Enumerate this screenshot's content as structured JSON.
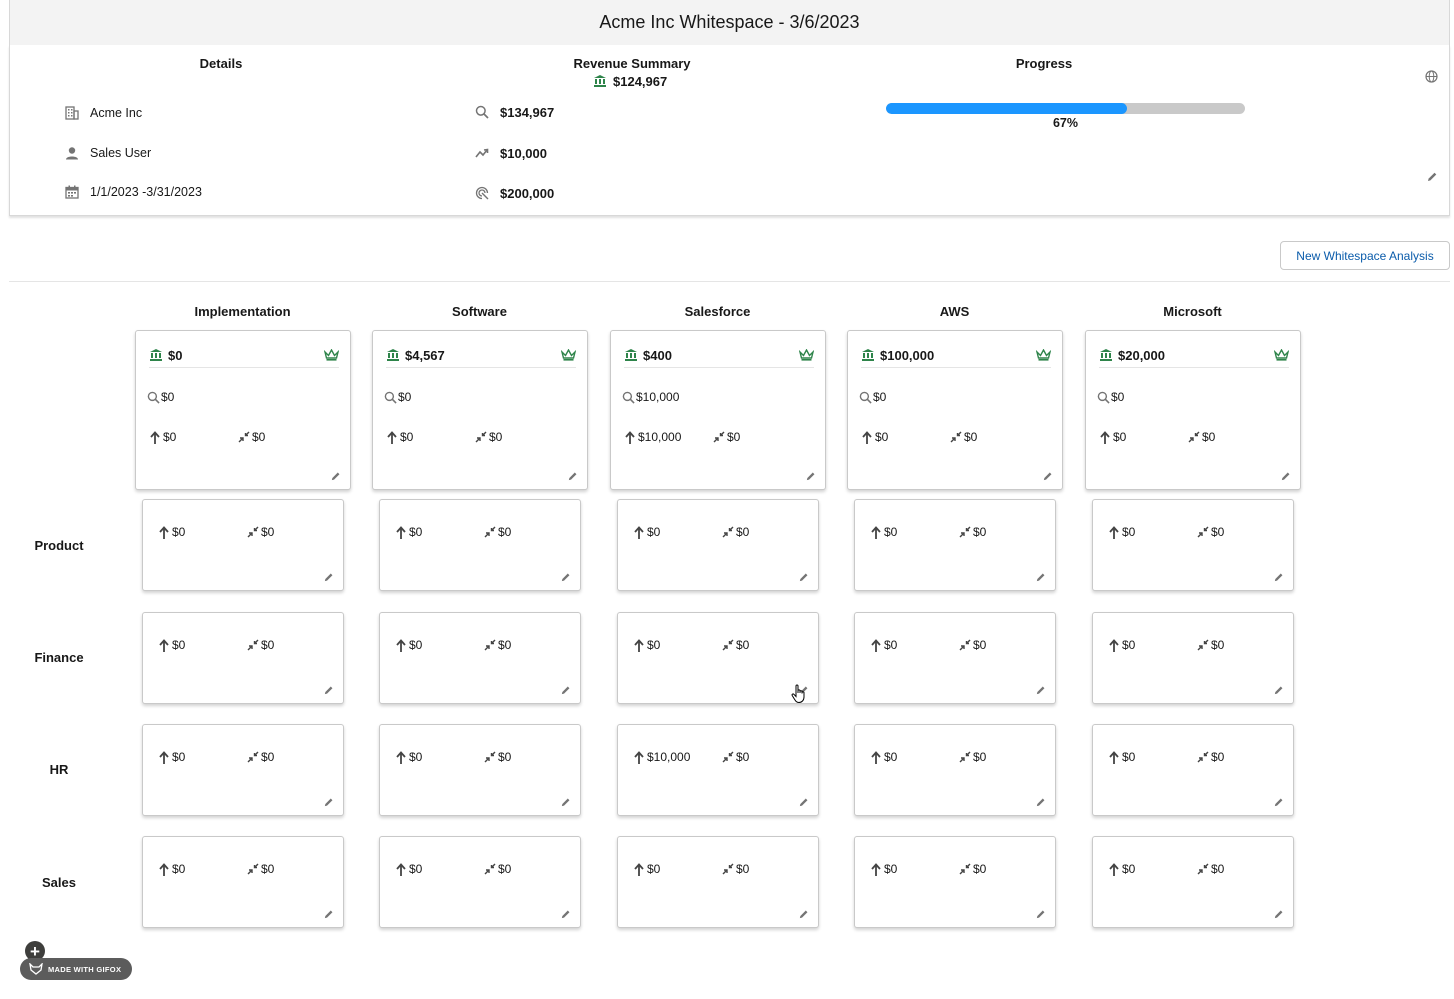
{
  "header": {
    "title": "Acme Inc Whitespace - 3/6/2023"
  },
  "details": {
    "heading": "Details",
    "account": "Acme Inc",
    "owner": "Sales User",
    "date_range": "1/1/2023 -3/31/2023"
  },
  "revenue_summary": {
    "heading": "Revenue Summary",
    "total": "$124,967",
    "pipeline": "$134,967",
    "growth": "$10,000",
    "target": "$200,000"
  },
  "progress": {
    "heading": "Progress",
    "percent_label": "67%",
    "value": 0.67
  },
  "actions": {
    "new_analysis_label": "New Whitespace Analysis"
  },
  "columns": [
    {
      "name": "Implementation",
      "total": "$0",
      "search": "$0",
      "up": "$0",
      "shrink": "$0"
    },
    {
      "name": "Software",
      "total": "$4,567",
      "search": "$0",
      "up": "$0",
      "shrink": "$0"
    },
    {
      "name": "Salesforce",
      "total": "$400",
      "search": "$10,000",
      "up": "$10,000",
      "shrink": "$0"
    },
    {
      "name": "AWS",
      "total": "$100,000",
      "search": "$0",
      "up": "$0",
      "shrink": "$0"
    },
    {
      "name": "Microsoft",
      "total": "$20,000",
      "search": "$0",
      "up": "$0",
      "shrink": "$0"
    }
  ],
  "rows": [
    {
      "name": "Product",
      "cells": [
        {
          "up": "$0",
          "shrink": "$0"
        },
        {
          "up": "$0",
          "shrink": "$0"
        },
        {
          "up": "$0",
          "shrink": "$0"
        },
        {
          "up": "$0",
          "shrink": "$0"
        },
        {
          "up": "$0",
          "shrink": "$0"
        }
      ]
    },
    {
      "name": "Finance",
      "cells": [
        {
          "up": "$0",
          "shrink": "$0"
        },
        {
          "up": "$0",
          "shrink": "$0"
        },
        {
          "up": "$0",
          "shrink": "$0"
        },
        {
          "up": "$0",
          "shrink": "$0"
        },
        {
          "up": "$0",
          "shrink": "$0"
        }
      ]
    },
    {
      "name": "HR",
      "cells": [
        {
          "up": "$0",
          "shrink": "$0"
        },
        {
          "up": "$0",
          "shrink": "$0"
        },
        {
          "up": "$10,000",
          "shrink": "$0"
        },
        {
          "up": "$0",
          "shrink": "$0"
        },
        {
          "up": "$0",
          "shrink": "$0"
        }
      ]
    },
    {
      "name": "Sales",
      "cells": [
        {
          "up": "$0",
          "shrink": "$0"
        },
        {
          "up": "$0",
          "shrink": "$0"
        },
        {
          "up": "$0",
          "shrink": "$0"
        },
        {
          "up": "$0",
          "shrink": "$0"
        },
        {
          "up": "$0",
          "shrink": "$0"
        }
      ]
    }
  ],
  "watermark": {
    "label": "MADE WITH GIFOX"
  },
  "colors": {
    "accent": "#1b96ff",
    "bank_icon": "#2e844a",
    "crown_icon": "#2e844a",
    "link": "#0b5cab"
  },
  "icons": {
    "account": "building-icon",
    "owner": "user-icon",
    "dates": "calendar-icon",
    "pipeline": "search-icon",
    "growth": "trend-up-icon",
    "target": "target-icon",
    "total": "bank-icon",
    "tier": "crown-icon",
    "upsell": "arrow-up-icon",
    "shrink": "shrink-icon",
    "edit": "pencil-icon",
    "settings": "globe-icon"
  }
}
